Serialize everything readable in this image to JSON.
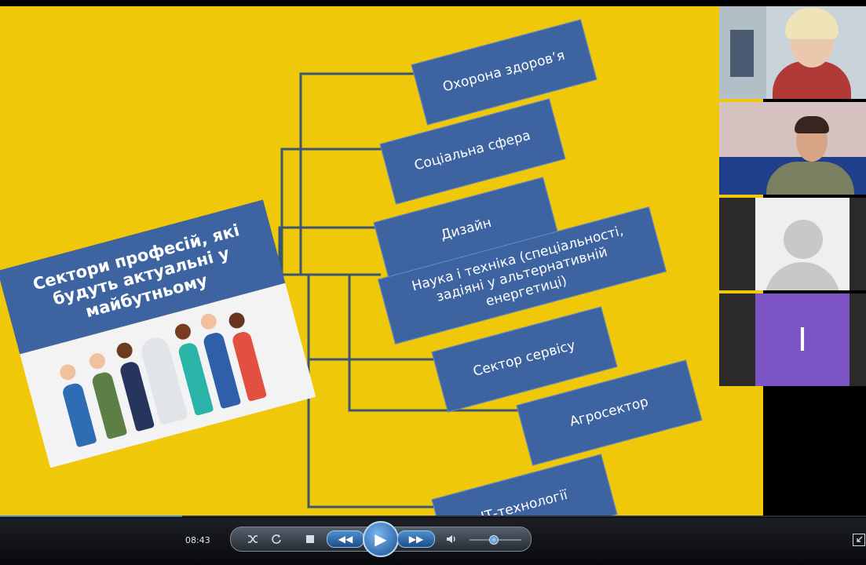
{
  "slide": {
    "title": "Сектори професій, які будуть актуальні  у майбутньому",
    "sectors": [
      "Охорона здоров’я",
      "Соціальна сфера",
      "Дизайн",
      "Наука і техніка (спеціальності, задіяні у альтернативній енергетиці)",
      "Сектор сервісу",
      "Агросектор",
      "ІТ-технології"
    ],
    "colors": {
      "background": "#f0c80a",
      "box": "#3d63a0",
      "line": "#3b5670"
    }
  },
  "participants": {
    "tile3_icon": "user-avatar-icon",
    "tile4_initial": "I",
    "tile4_color": "#7c55c4"
  },
  "player": {
    "time": "08:43",
    "progress": 0.21,
    "volume": 0.45,
    "icons": [
      "shuffle-icon",
      "repeat-icon",
      "stop-icon",
      "previous-icon",
      "play-icon",
      "next-icon",
      "volume-icon",
      "switch-mode-icon"
    ]
  }
}
